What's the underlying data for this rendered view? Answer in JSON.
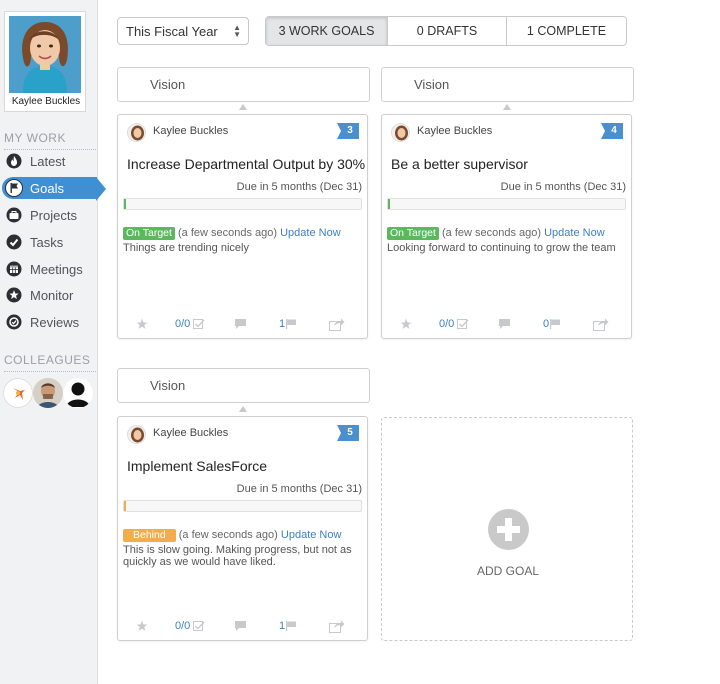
{
  "user": {
    "name": "Kaylee Buckles"
  },
  "sidebar": {
    "my_work_label": "MY WORK",
    "items": [
      {
        "label": "Latest",
        "icon": "flame-icon"
      },
      {
        "label": "Goals",
        "icon": "flag-icon",
        "active": true
      },
      {
        "label": "Projects",
        "icon": "briefcase-icon"
      },
      {
        "label": "Tasks",
        "icon": "check-circle-icon"
      },
      {
        "label": "Meetings",
        "icon": "calendar-icon"
      },
      {
        "label": "Monitor",
        "icon": "star-icon"
      },
      {
        "label": "Reviews",
        "icon": "review-icon"
      }
    ],
    "colleagues_label": "COLLEAGUES"
  },
  "filter": {
    "selected": "This Fiscal Year"
  },
  "tabs": [
    {
      "label": "3 WORK GOALS",
      "active": true
    },
    {
      "label": "0 DRAFTS",
      "active": false
    },
    {
      "label": "1 COMPLETE",
      "active": false
    }
  ],
  "vision_label": "Vision",
  "goals": [
    {
      "owner": "Kaylee Buckles",
      "badge": "3",
      "title": "Increase Departmental Output by 30%",
      "due": "Due in 5 months (Dec 31)",
      "progress": 0.01,
      "status": "On Target",
      "status_color": "#5cb85c",
      "status_time": "(a few seconds ago)",
      "update_label": "Update Now",
      "note": "Things are trending nicely",
      "tasks": "0/0",
      "comments": "",
      "check_ins": "1"
    },
    {
      "owner": "Kaylee Buckles",
      "badge": "4",
      "title": "Be a better supervisor",
      "due": "Due in 5 months (Dec 31)",
      "progress": 0.01,
      "status": "On Target",
      "status_color": "#5cb85c",
      "status_time": "(a few seconds ago)",
      "update_label": "Update Now",
      "note": "Looking forward to continuing to grow the team",
      "tasks": "0/0",
      "comments": "",
      "check_ins": "0"
    },
    {
      "owner": "Kaylee Buckles",
      "badge": "5",
      "title": "Implement SalesForce",
      "due": "Due in 5 months (Dec 31)",
      "progress": 0.01,
      "status": "Behind",
      "status_color": "#f0ad4e",
      "status_time": "(a few seconds ago)",
      "update_label": "Update Now",
      "note": "This is slow going. Making progress, but not as quickly as we would have liked.",
      "tasks": "0/0",
      "comments": "",
      "check_ins": "1"
    }
  ],
  "add_goal_label": "ADD GOAL",
  "colors": {
    "accent": "#3f8fd2",
    "link": "#3d7fc1",
    "on_target": "#5cb85c",
    "behind": "#f0ad4e"
  }
}
